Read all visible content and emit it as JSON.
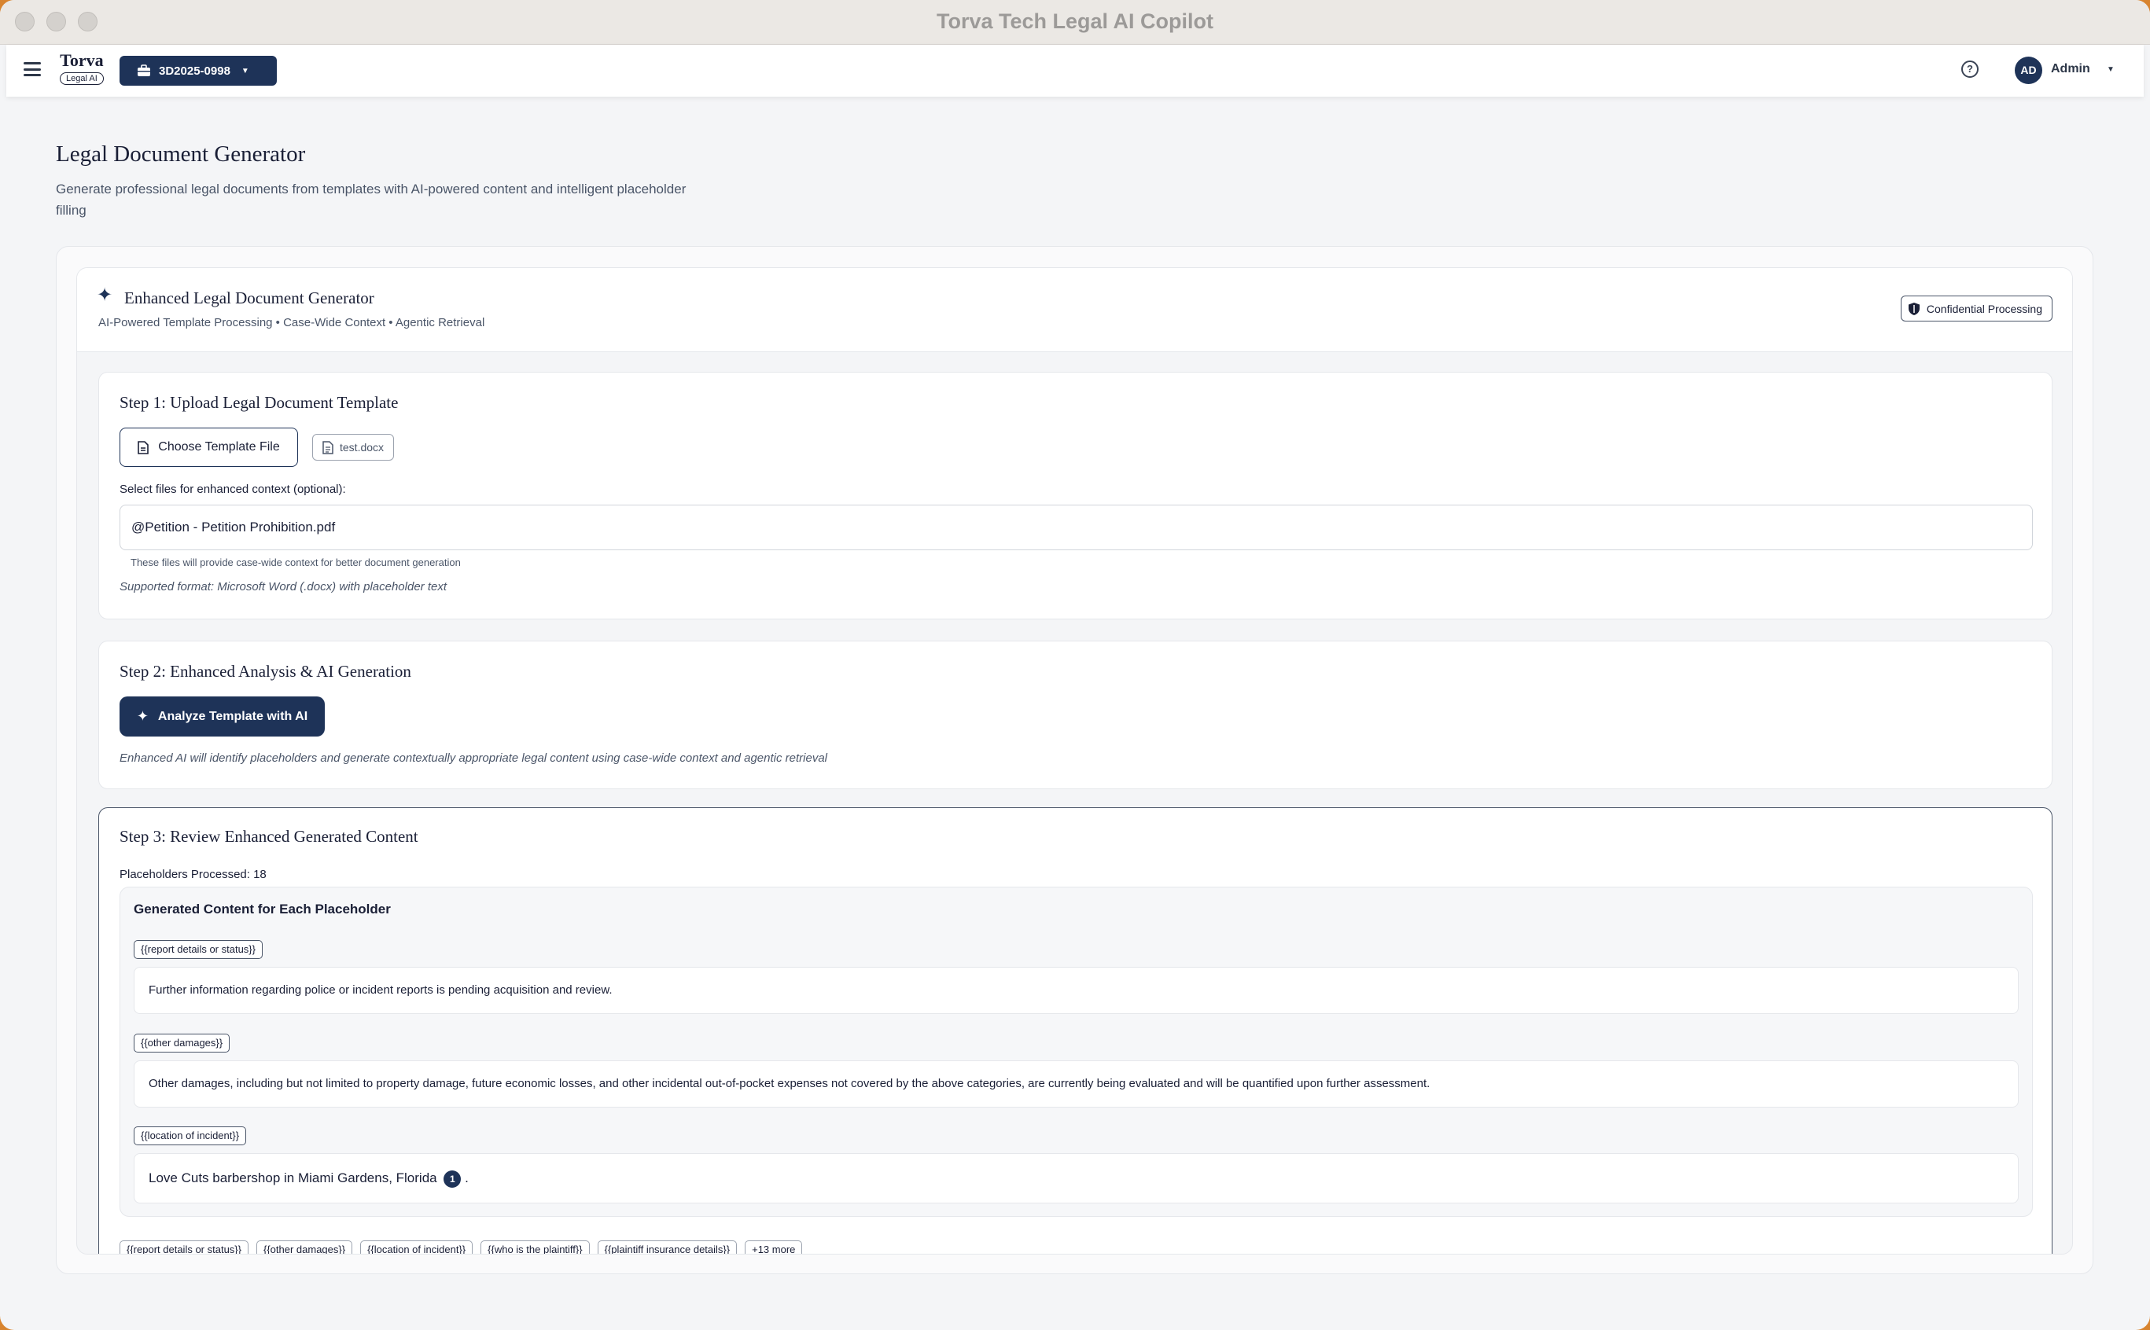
{
  "window": {
    "title": "Torva Tech Legal AI Copilot"
  },
  "appbar": {
    "brand_name": "Torva",
    "brand_badge": "Legal AI",
    "case_id": "3D2025-0998",
    "help_symbol": "?",
    "user_initials": "AD",
    "user_label": "Admin"
  },
  "page": {
    "title": "Legal Document Generator",
    "subtitle": "Generate professional legal documents from templates with AI-powered content and intelligent placeholder filling"
  },
  "generator": {
    "title": "Enhanced Legal Document Generator",
    "subtitle": "AI-Powered Template Processing • Case-Wide Context • Agentic Retrieval",
    "badge": "Confidential Processing"
  },
  "step1": {
    "title": "Step 1: Upload Legal Document Template",
    "choose_label": "Choose Template File",
    "file_name": "test.docx",
    "context_label": "Select files for enhanced context (optional):",
    "context_value": "@Petition - Petition Prohibition.pdf",
    "helper": "These files will provide case-wide context for better document generation",
    "format_note": "Supported format: Microsoft Word (.docx) with placeholder text"
  },
  "step2": {
    "title": "Step 2: Enhanced Analysis & AI Generation",
    "button_label": "Analyze Template with AI",
    "note": "Enhanced AI will identify placeholders and generate contextually appropriate legal content using case-wide context and agentic retrieval"
  },
  "step3": {
    "title": "Step 3: Review Enhanced Generated Content",
    "processed": "Placeholders Processed: 18",
    "panel_title": "Generated Content for Each Placeholder",
    "items": [
      {
        "tag": "{{report details or status}}",
        "content": "Further information regarding police or incident reports is pending acquisition and review."
      },
      {
        "tag": "{{other damages}}",
        "content": "Other damages, including but not limited to property damage, future economic losses, and other incidental out-of-pocket expenses not covered by the above categories, are currently being evaluated and will be quantified upon further assessment."
      },
      {
        "tag": "{{location of incident}}",
        "content": "Love Cuts barbershop in Miami Gardens, Florida",
        "citation": "1",
        "suffix": "."
      }
    ],
    "chips": [
      "{{report details or status}}",
      "{{other damages}}",
      "{{location of incident}}",
      "{{who is the plaintiff}}",
      "{{plaintiff insurance details}}",
      "+13 more"
    ]
  },
  "colors": {
    "primary": "#1e3358",
    "desktop": "#d8842f"
  }
}
